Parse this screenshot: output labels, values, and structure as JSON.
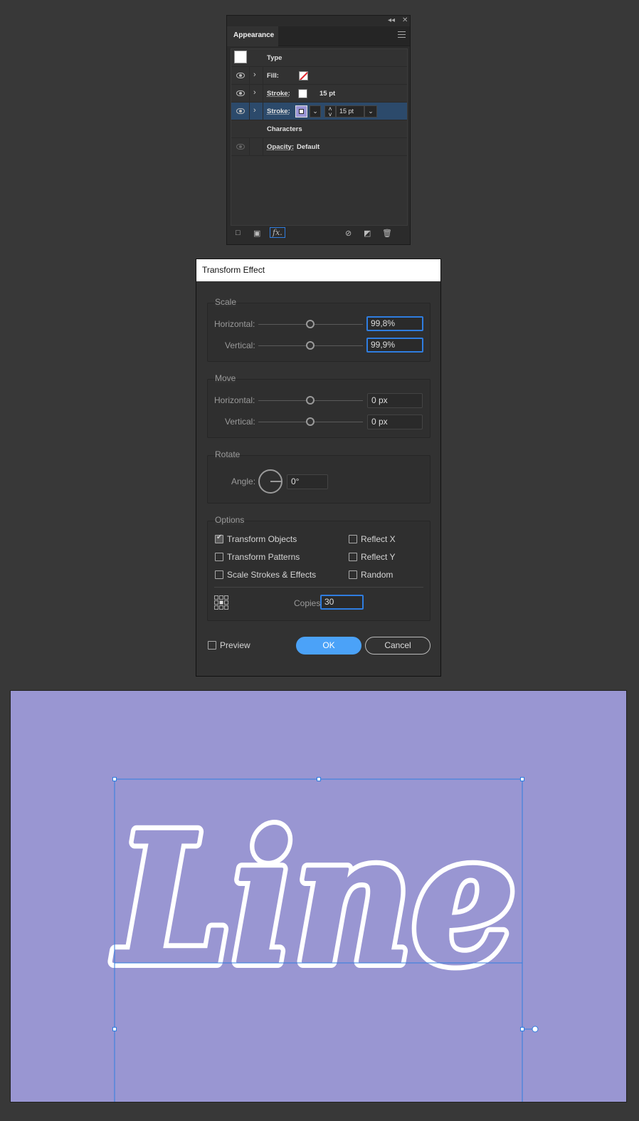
{
  "appearance": {
    "collapse_glyph": "◂◂",
    "close_glyph": "✕",
    "tab": "Appearance",
    "object_type": "Type",
    "rows": {
      "fill": {
        "label": "Fill:"
      },
      "stroke1": {
        "label": "Stroke:",
        "weight": "15 pt"
      },
      "stroke2": {
        "label": "Stroke:",
        "weight": "15 pt"
      },
      "characters": {
        "label": "Characters"
      },
      "opacity": {
        "label": "Opacity:",
        "value": "Default"
      }
    },
    "footer_icons": [
      "new-stroke-icon",
      "new-fill-icon",
      "fx-icon",
      "clear-appearance-icon",
      "duplicate-item-icon",
      "delete-item-icon"
    ],
    "fx_label": "fx."
  },
  "dialog": {
    "title": "Transform Effect",
    "scale": {
      "title": "Scale",
      "horizontal_label": "Horizontal:",
      "horizontal_value": "99,8%",
      "vertical_label": "Vertical:",
      "vertical_value": "99,9%"
    },
    "move": {
      "title": "Move",
      "horizontal_label": "Horizontal:",
      "horizontal_value": "0 px",
      "vertical_label": "Vertical:",
      "vertical_value": "0 px"
    },
    "rotate": {
      "title": "Rotate",
      "angle_label": "Angle:",
      "angle_value": "0°"
    },
    "options": {
      "title": "Options",
      "transform_objects": {
        "label": "Transform Objects",
        "checked": true
      },
      "transform_patterns": {
        "label": "Transform Patterns",
        "checked": false
      },
      "scale_strokes": {
        "label": "Scale Strokes & Effects",
        "checked": false
      },
      "reflect_x": {
        "label": "Reflect X",
        "checked": false
      },
      "reflect_y": {
        "label": "Reflect Y",
        "checked": false
      },
      "random": {
        "label": "Random",
        "checked": false
      },
      "copies_label": "Copies",
      "copies_value": "30"
    },
    "preview_label": "Preview",
    "ok_label": "OK",
    "cancel_label": "Cancel"
  },
  "canvas": {
    "background": "#9996d2",
    "artwork_text": "Line",
    "stroke_color": "#ffffff",
    "selection_color": "#2f7de0"
  }
}
